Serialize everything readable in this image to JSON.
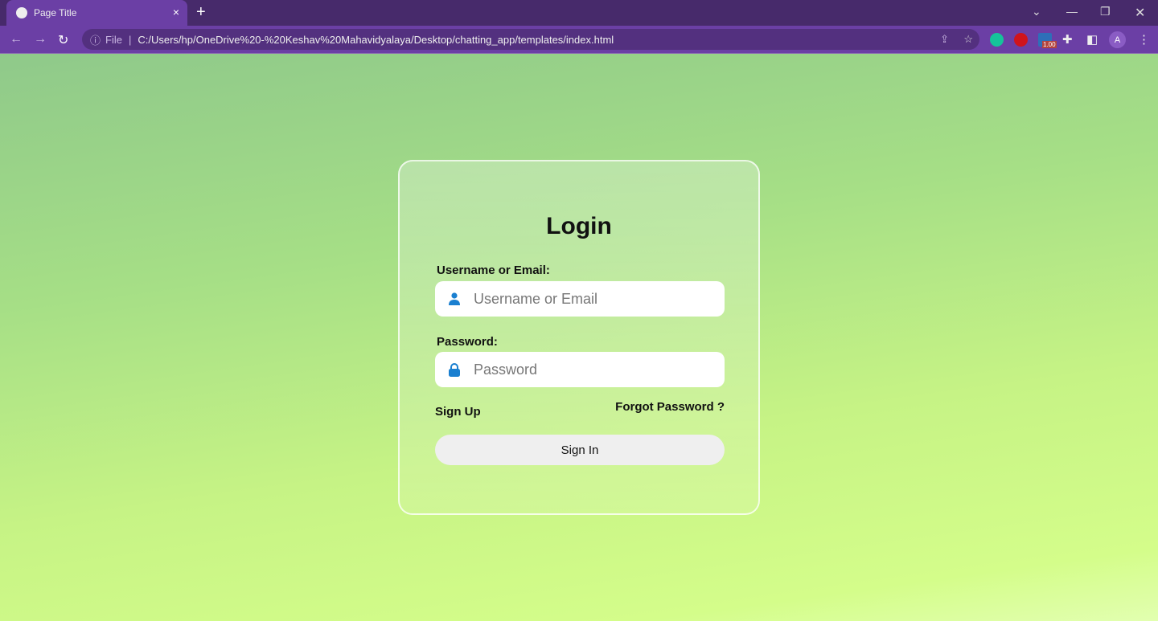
{
  "browser": {
    "tab_title": "Page Title",
    "new_tab": "+",
    "close_tab": "×",
    "address_prefix": "File",
    "url": "C:/Users/hp/OneDrive%20-%20Keshav%20Mahavidyalaya/Desktop/chatting_app/templates/index.html",
    "extension_badge": "1.00",
    "profile_initial": "A",
    "colors": {
      "tabbar": "#472a6b",
      "toolbar": "#6b3fa5"
    }
  },
  "login": {
    "title": "Login",
    "username_label": "Username or Email:",
    "username_placeholder": "Username or Email",
    "username_icon": "user-icon",
    "password_label": "Password:",
    "password_placeholder": "Password",
    "password_icon": "lock-icon",
    "signup_link": "Sign Up",
    "forgot_link": "Forgot Password ?",
    "signin_button": "Sign In",
    "icon_color": "#1a7fd0"
  }
}
